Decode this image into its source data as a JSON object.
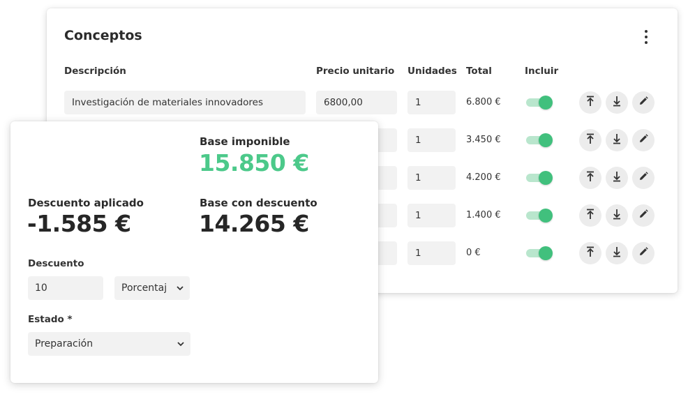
{
  "concepts": {
    "title": "Conceptos",
    "columns": {
      "description": "Descripción",
      "unit_price": "Precio unitario",
      "units": "Unidades",
      "total": "Total",
      "include": "Incluir"
    },
    "rows": [
      {
        "description": "Investigación de materiales innovadores",
        "unit_price": "6800,00",
        "units": "1",
        "total": "6.800 €",
        "include": true
      },
      {
        "description": "",
        "unit_price": "",
        "units": "1",
        "total": "3.450 €",
        "include": true
      },
      {
        "description": "",
        "unit_price": "",
        "units": "1",
        "total": "4.200 €",
        "include": true
      },
      {
        "description": "",
        "unit_price": "",
        "units": "1",
        "total": "1.400 €",
        "include": true
      },
      {
        "description": "",
        "unit_price": "",
        "units": "1",
        "total": "0 €",
        "include": true
      }
    ],
    "icons": {
      "more": "more-vertical-icon",
      "move_up": "arrow-to-top-icon",
      "move_down": "arrow-to-bottom-icon",
      "edit": "pencil-icon"
    }
  },
  "summary": {
    "base_label": "Base imponible",
    "base_value": "15.850 €",
    "discount_applied_label": "Descuento aplicado",
    "discount_applied_value": "-1.585 €",
    "discounted_base_label": "Base con descuento",
    "discounted_base_value": "14.265 €",
    "discount_label": "Descuento",
    "discount_value": "10",
    "discount_type": "Porcentaj",
    "status_label": "Estado *",
    "status_value": "Preparación"
  },
  "colors": {
    "accent_green": "#4cc98a",
    "toggle_knob": "#41c07d",
    "toggle_track": "#b9e6cd",
    "field_bg": "#f2f2f2"
  }
}
